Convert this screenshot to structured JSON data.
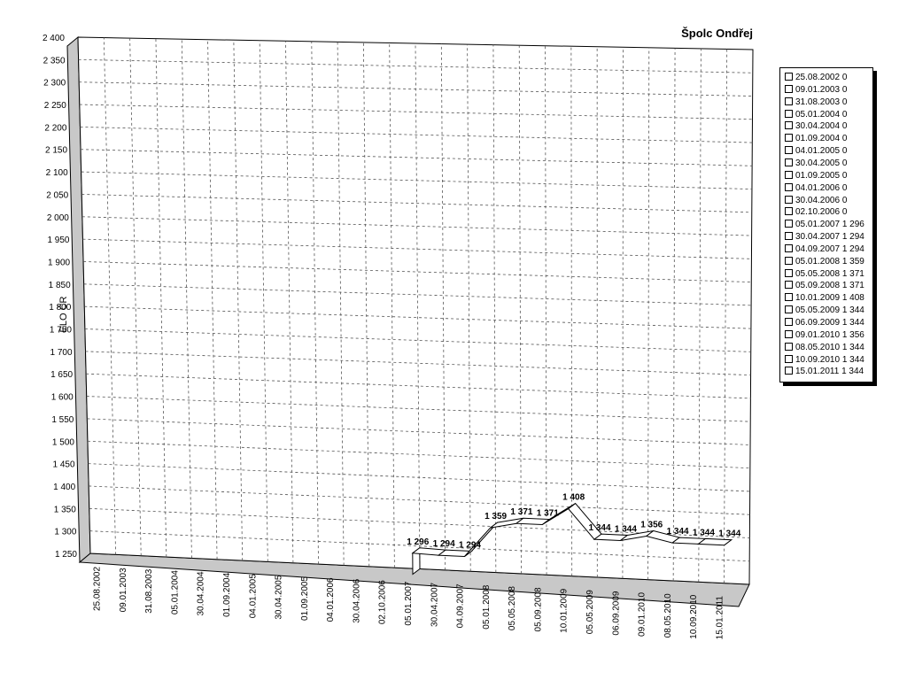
{
  "chart_data": {
    "type": "line",
    "title": "Špolc Ondřej",
    "ylabel": "ELO ČR",
    "xlabel": "",
    "ylim": [
      1250,
      2400
    ],
    "yticks": [
      "2 400",
      "2 350",
      "2 300",
      "2 250",
      "2 200",
      "2 150",
      "2 100",
      "2 050",
      "2 000",
      "1 950",
      "1 900",
      "1 850",
      "1 800",
      "1 750",
      "1 700",
      "1 650",
      "1 600",
      "1 550",
      "1 500",
      "1 450",
      "1 400",
      "1 350",
      "1 300",
      "1 250"
    ],
    "categories": [
      "25.08.2002",
      "09.01.2003",
      "31.08.2003",
      "05.01.2004",
      "30.04.2004",
      "01.09.2004",
      "04.01.2005",
      "30.04.2005",
      "01.09.2005",
      "04.01.2006",
      "30.04.2006",
      "02.10.2006",
      "05.01.2007",
      "30.04.2007",
      "04.09.2007",
      "05.01.2008",
      "05.05.2008",
      "05.09.2008",
      "10.01.2009",
      "05.05.2009",
      "06.09.2009",
      "09.01.2010",
      "08.05.2010",
      "10.09.2010",
      "15.01.2011"
    ],
    "values": [
      0,
      0,
      0,
      0,
      0,
      0,
      0,
      0,
      0,
      0,
      0,
      0,
      1296,
      1294,
      1294,
      1359,
      1371,
      1371,
      1408,
      1344,
      1344,
      1356,
      1344,
      1344,
      1344
    ],
    "value_labels": [
      "",
      "",
      "",
      "",
      "",
      "",
      "",
      "",
      "",
      "",
      "",
      "",
      "1 296",
      "1 294",
      "1 294",
      "1 359",
      "1 371",
      "1 371",
      "1 408",
      "1 344",
      "1 344",
      "1 356",
      "1 344",
      "1 344",
      "1 344"
    ],
    "legend_position": "right",
    "legend": [
      "25.08.2002 0",
      "09.01.2003 0",
      "31.08.2003 0",
      "05.01.2004 0",
      "30.04.2004 0",
      "01.09.2004 0",
      "04.01.2005 0",
      "30.04.2005 0",
      "01.09.2005 0",
      "04.01.2006 0",
      "30.04.2006 0",
      "02.10.2006 0",
      "05.01.2007 1 296",
      "30.04.2007 1 294",
      "04.09.2007 1 294",
      "05.01.2008 1 359",
      "05.05.2008 1 371",
      "05.09.2008 1 371",
      "10.01.2009 1 408",
      "05.05.2009 1 344",
      "06.09.2009 1 344",
      "09.01.2010 1 356",
      "08.05.2010 1 344",
      "10.09.2010 1 344",
      "15.01.2011 1 344"
    ],
    "grid": true,
    "style": "3d-ribbon"
  }
}
